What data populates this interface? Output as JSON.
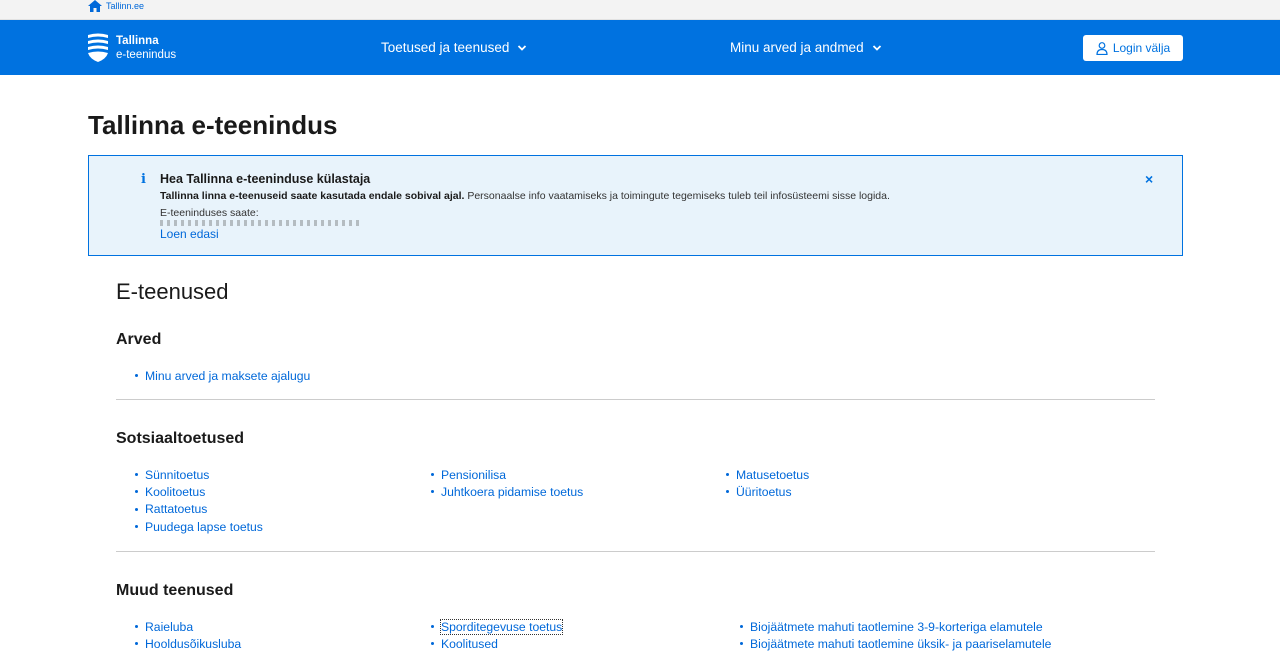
{
  "topbar": {
    "home_label": "Tallinn.ee"
  },
  "navbar": {
    "logo_line1": "Tallinna",
    "logo_line2": "e-teenindus",
    "menu1": "Toetused ja teenused",
    "menu2": "Minu arved ja andmed",
    "login": "Login välja"
  },
  "page_title": "Tallinna e-teenindus",
  "notice": {
    "icon": "i",
    "title": "Hea Tallinna e-teeninduse külastaja",
    "body_bold": "Tallinna linna e-teenuseid saate kasutada endale sobival ajal.",
    "body_rest": " Personaalse info vaatamiseks ja toimingute tegemiseks tuleb teil infosüsteemi sisse logida.",
    "body_line2": "E-teeninduses saate:",
    "read_more": "Loen edasi",
    "close": "×"
  },
  "services": {
    "title": "E-teenused",
    "arved": {
      "title": "Arved",
      "items": [
        "Minu arved ja maksete ajalugu"
      ]
    },
    "sotsiaal": {
      "title": "Sotsiaaltoetused",
      "col1": [
        "Sünnitoetus",
        "Koolitoetus",
        "Rattatoetus",
        "Puudega lapse toetus"
      ],
      "col2": [
        "Pensionilisa",
        "Juhtkoera pidamise toetus"
      ],
      "col3": [
        "Matusetoetus",
        "Üüritoetus"
      ]
    },
    "muud": {
      "title": "Muud teenused",
      "col1": [
        "Raieluba",
        "Hooldusõikusluba"
      ],
      "col2": [
        "Sporditegevuse toetus",
        "Koolitused"
      ],
      "col3": [
        "Biojäätmete mahuti taotlemine 3-9-korteriga elamutele",
        "Biojäätmete mahuti taotlemine üksik- ja paariselamutele"
      ]
    }
  },
  "colors": {
    "brand_blue": "#0072e0",
    "link": "#0068d9",
    "notice_bg": "#e8f3fb"
  }
}
